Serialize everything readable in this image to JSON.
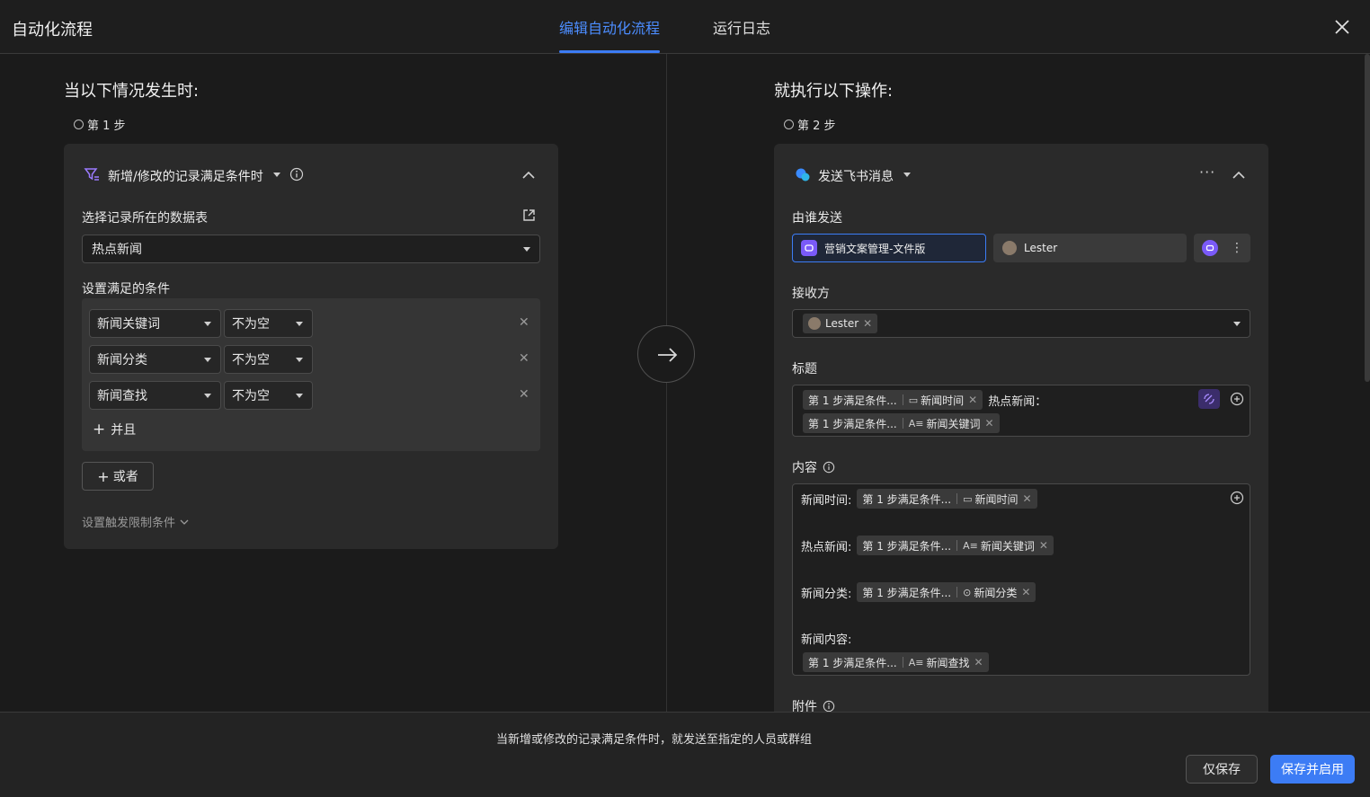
{
  "header": {
    "title": "自动化流程",
    "tabs": [
      {
        "label": "编辑自动化流程"
      },
      {
        "label": "运行日志"
      }
    ]
  },
  "trigger": {
    "section_title": "当以下情况发生时:",
    "step": "第 1 步",
    "type_label": "新增/修改的记录满足条件时",
    "table_label": "选择记录所在的数据表",
    "table_value": "热点新闻",
    "condition_label": "设置满足的条件",
    "conditions": [
      {
        "field": "新闻关键词",
        "op": "不为空"
      },
      {
        "field": "新闻分类",
        "op": "不为空"
      },
      {
        "field": "新闻查找",
        "op": "不为空"
      }
    ],
    "and_label": "并且",
    "or_label": "或者",
    "limit_label": "设置触发限制条件"
  },
  "action": {
    "section_title": "就执行以下操作:",
    "step": "第 2 步",
    "type_label": "发送飞书消息",
    "sender_label": "由谁发送",
    "sender_bot": "营销文案管理-文件版",
    "sender_user": "Lester",
    "receiver_label": "接收方",
    "receiver_user": "Lester",
    "title_label": "标题",
    "title_line1": {
      "step": "第 1 步满足条件...",
      "field": "新闻时间",
      "text": "热点新闻："
    },
    "title_line2": {
      "step": "第 1 步满足条件...",
      "field": "新闻关键词"
    },
    "content_label": "内容",
    "content_rows": [
      {
        "prefix": "新闻时间:",
        "step": "第 1 步满足条件...",
        "field": "新闻时间",
        "icon": "calendar-icon"
      },
      {
        "prefix": "热点新闻:",
        "step": "第 1 步满足条件...",
        "field": "新闻关键词",
        "icon": "text-icon"
      },
      {
        "prefix": "新闻分类:",
        "step": "第 1 步满足条件...",
        "field": "新闻分类",
        "icon": "option-icon"
      },
      {
        "prefix": "新闻内容:",
        "step": "第 1 步满足条件...",
        "field": "新闻查找",
        "icon": "text-icon"
      }
    ],
    "attachment_label": "附件"
  },
  "footer": {
    "summary": "当新增或修改的记录满足条件时，就发送至指定的人员或群组",
    "save_only": "仅保存",
    "save_enable": "保存并启用"
  },
  "colors": {
    "accent": "#3c7cf5",
    "purple": "#7a5af8"
  }
}
